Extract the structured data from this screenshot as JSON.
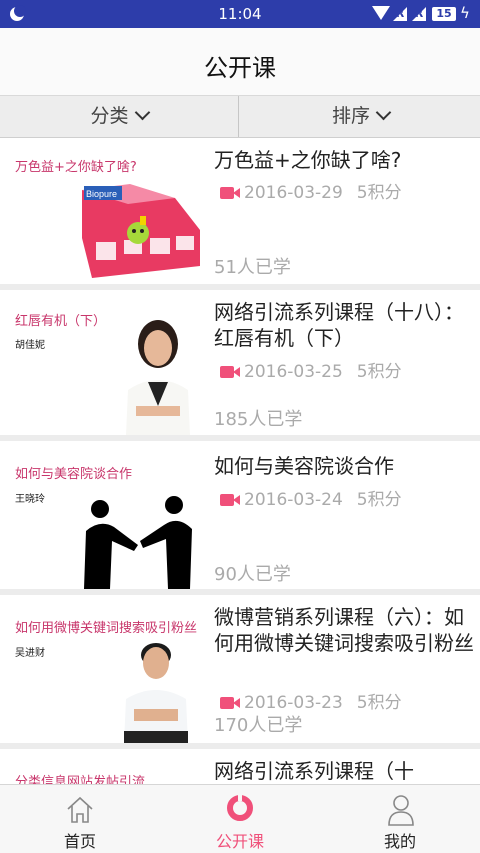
{
  "status": {
    "time": "11:04",
    "sig1": "R",
    "sig2": "R",
    "battery": "15"
  },
  "header": {
    "title": "公开课"
  },
  "filters": {
    "category": "分类",
    "sort": "排序"
  },
  "courses": [
    {
      "thumb_title": "万色益+之你缺了啥?",
      "thumb_author": "",
      "name": "万色益+之你缺了啥?",
      "date": "2016-03-29",
      "points": "5积分",
      "learners": "51人已学",
      "product_label": "Biopure"
    },
    {
      "thumb_title": "红唇有机（下）",
      "thumb_author": "胡佳妮",
      "name": "网络引流系列课程（十八）：红唇有机（下）",
      "date": "2016-03-25",
      "points": "5积分",
      "learners": "185人已学"
    },
    {
      "thumb_title": "如何与美容院谈合作",
      "thumb_author": "王晓玲",
      "name": "如何与美容院谈合作",
      "date": "2016-03-24",
      "points": "5积分",
      "learners": "90人已学"
    },
    {
      "thumb_title": "如何用微博关键词搜索吸引粉丝",
      "thumb_author": "吴进财",
      "name": "微博营销系列课程（六）：如何用微博关键词搜索吸引粉丝",
      "date": "2016-03-23",
      "points": "5积分",
      "learners": "170人已学"
    },
    {
      "thumb_title": "分类信息网站发帖引流",
      "thumb_author": "",
      "name": "网络引流系列课程（十"
    }
  ],
  "tabbar": {
    "home": "首页",
    "courses": "公开课",
    "mine": "我的"
  },
  "colors": {
    "accent": "#f0507a",
    "statusbar": "#2d3daa",
    "thumb_text": "#c8366b"
  }
}
